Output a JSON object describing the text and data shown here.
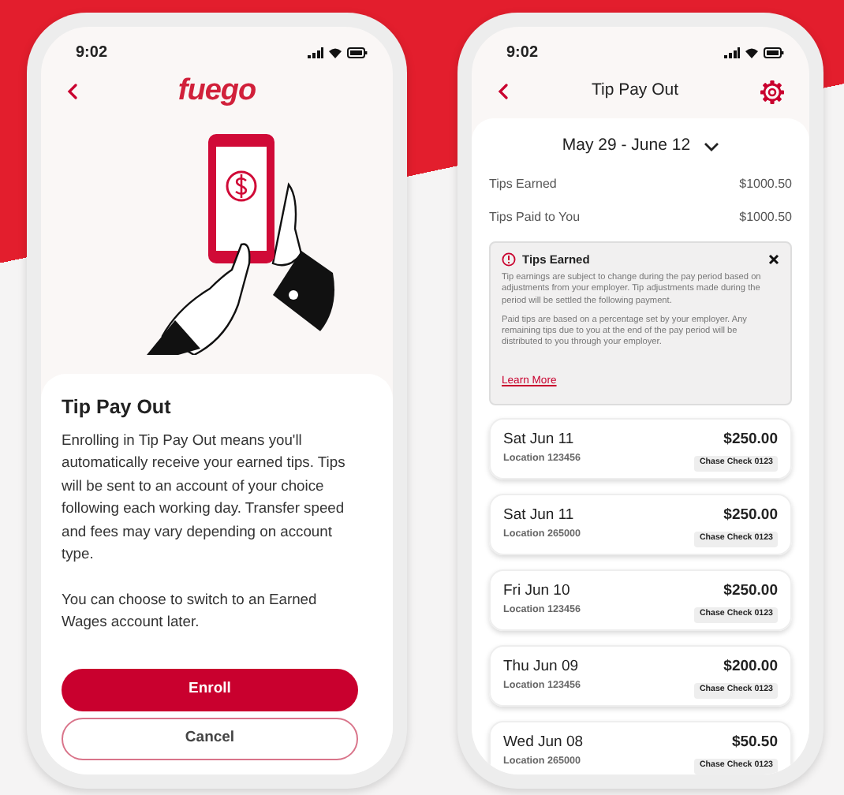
{
  "left_phone": {
    "status_time": "9:02",
    "logo": "fuego",
    "title": "Tip Pay Out",
    "paragraphs": [
      "Enrolling in Tip Pay Out means you'll automatically receive your earned tips. Tips will be sent to an account of your choice following each working day. Transfer speed and fees may vary depending on account type.",
      "You can choose to switch to an Earned Wages account later."
    ],
    "buttons": [
      {
        "label": "Enroll",
        "kind": "primary"
      },
      {
        "label": "Cancel",
        "kind": "outline"
      }
    ]
  },
  "right_phone": {
    "status_time": "9:02",
    "title": "Tip Pay Out",
    "date_range": "May 29 - June 12",
    "summary": [
      {
        "label": "Tips Earned",
        "value": "$1000.50"
      },
      {
        "label": "Tips Paid to You",
        "value": "$1000.50"
      }
    ],
    "info": {
      "title": "Tips Earned",
      "paragraphs": [
        "Tip earnings are subject to change during the pay period based on adjustments from your employer. Tip adjustments made during the period will be settled the following payment.",
        "Paid tips are based on a percentage set by your employer. Any remaining tips due to you at the end of the pay period will be distributed to you through your employer."
      ],
      "link": "Learn More"
    },
    "payouts": [
      {
        "date": "Sat Jun 11",
        "location": "Location 123456",
        "amount": "$250.00",
        "account": "Chase Check 0123"
      },
      {
        "date": "Sat Jun 11",
        "location": "Location 265000",
        "amount": "$250.00",
        "account": "Chase Check 0123"
      },
      {
        "date": "Fri Jun 10",
        "location": "Location 123456",
        "amount": "$250.00",
        "account": "Chase Check 0123"
      },
      {
        "date": "Thu Jun 09",
        "location": "Location 123456",
        "amount": "$200.00",
        "account": "Chase Check 0123"
      },
      {
        "date": "Wed Jun 08",
        "location": "Location 265000",
        "amount": "$50.50",
        "account": "Chase Check 0123"
      }
    ]
  }
}
